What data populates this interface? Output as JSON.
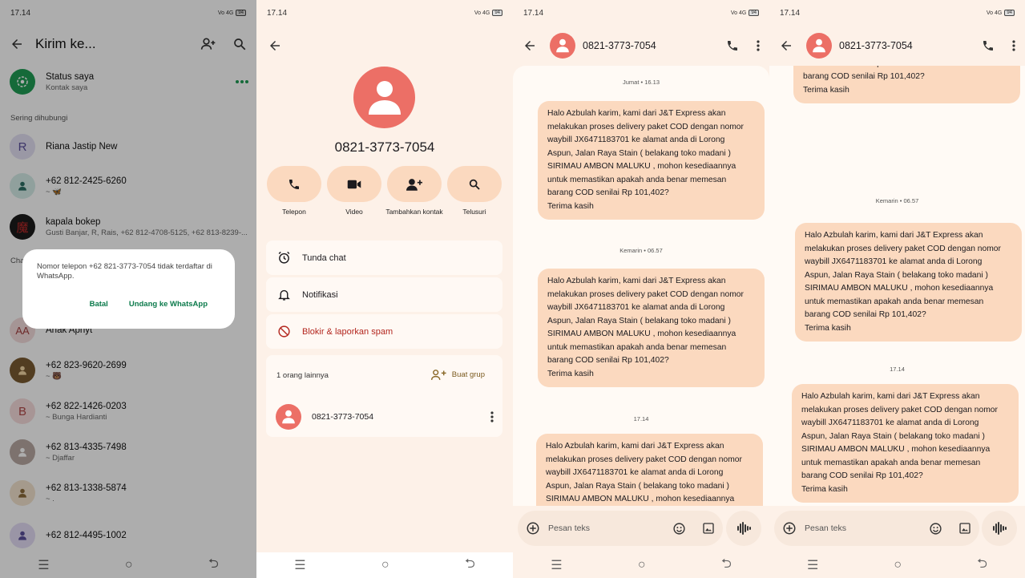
{
  "statusbar": {
    "time": "17.14",
    "signal": "Vo 4G",
    "battery": "94"
  },
  "whatsapp": {
    "title": "Kirim ke...",
    "status": {
      "name": "Status saya",
      "sub": "Kontak saya"
    },
    "section_frequent": "Sering dihubungi",
    "section_chat": "Cha",
    "contacts": [
      {
        "name": "Riana Jastip New",
        "sub": "",
        "initial": "R",
        "color": "#e3e0f4",
        "fg": "#5b4e9b"
      },
      {
        "name": "+62 812-2425-6260",
        "sub": "~ 🦋",
        "initial": "",
        "color": "#d4ece8",
        "fg": "#2c6e63"
      },
      {
        "name": "kapala bokep",
        "sub": "Gusti Banjar, R, Rais, +62 812-4708-5125, +62 813-8239-...",
        "initial": "魔",
        "color": "#1b1b1b",
        "fg": "#c02a2a"
      },
      {
        "name": "Anak Aphyt",
        "sub": "",
        "initial": "AA",
        "color": "#f4dcdc",
        "fg": "#a24040"
      },
      {
        "name": "+62 823-9620-2699",
        "sub": "~ 🐻",
        "initial": "",
        "color": "#7a5b32",
        "fg": "#f3d8a6"
      },
      {
        "name": "+62 822-1426-0203",
        "sub": "~ Bunga Hardianti",
        "initial": "B",
        "color": "#f7dcdc",
        "fg": "#b04848"
      },
      {
        "name": "+62 813-4335-7498",
        "sub": "~ Djaffar",
        "initial": "",
        "color": "#b8a9a3",
        "fg": "#ffffff"
      },
      {
        "name": "+62 813-1338-5874",
        "sub": "~ .",
        "initial": "",
        "color": "#f3e4cf",
        "fg": "#8b6a3a"
      },
      {
        "name": "+62 812-4495-1002",
        "sub": "",
        "initial": "",
        "color": "#e3dcf5",
        "fg": "#5b4e9b"
      }
    ],
    "dialog": {
      "message": "Nomor telepon +62 821-3773-7054 tidak terdaftar di WhatsApp.",
      "cancel": "Batal",
      "invite": "Undang ke WhatsApp"
    }
  },
  "contact_info": {
    "number": "0821-3773-7054",
    "actions": [
      {
        "label": "Telepon"
      },
      {
        "label": "Video"
      },
      {
        "label": "Tambahkan kontak"
      },
      {
        "label": "Telusuri"
      }
    ],
    "options": {
      "snooze": "Tunda chat",
      "notifications": "Notifikasi",
      "block": "Blokir & laporkan spam"
    },
    "others": {
      "label": "1 orang lainnya",
      "group_button": "Buat grup",
      "member": "0821-3773-7054"
    }
  },
  "messages": {
    "title": "0821-3773-7054",
    "compose_placeholder": "Pesan teks",
    "body_lines": [
      "Halo Azbulah karim, kami dari J&T Express akan",
      "melakukan proses delivery paket COD dengan nomor",
      "waybill JX6471183701 ke alamat anda di Lorong",
      "Aspun, Jalan Raya Stain ( belakang toko madani )",
      "SIRIMAU AMBON MALUKU , mohon kesediaannya",
      "untuk memastikan apakah anda benar memesan",
      "barang COD senilai Rp 101,402?",
      "Terima kasih"
    ],
    "dates": {
      "friday": "Jumat • 16.13",
      "yesterday": "Kemarin • 06.57",
      "today": "17.14"
    }
  },
  "colors": {
    "accent": "#ec6f66",
    "pill": "#fbd9bf",
    "wa_green": "#0b7a4b",
    "block_red": "#b3261e"
  }
}
